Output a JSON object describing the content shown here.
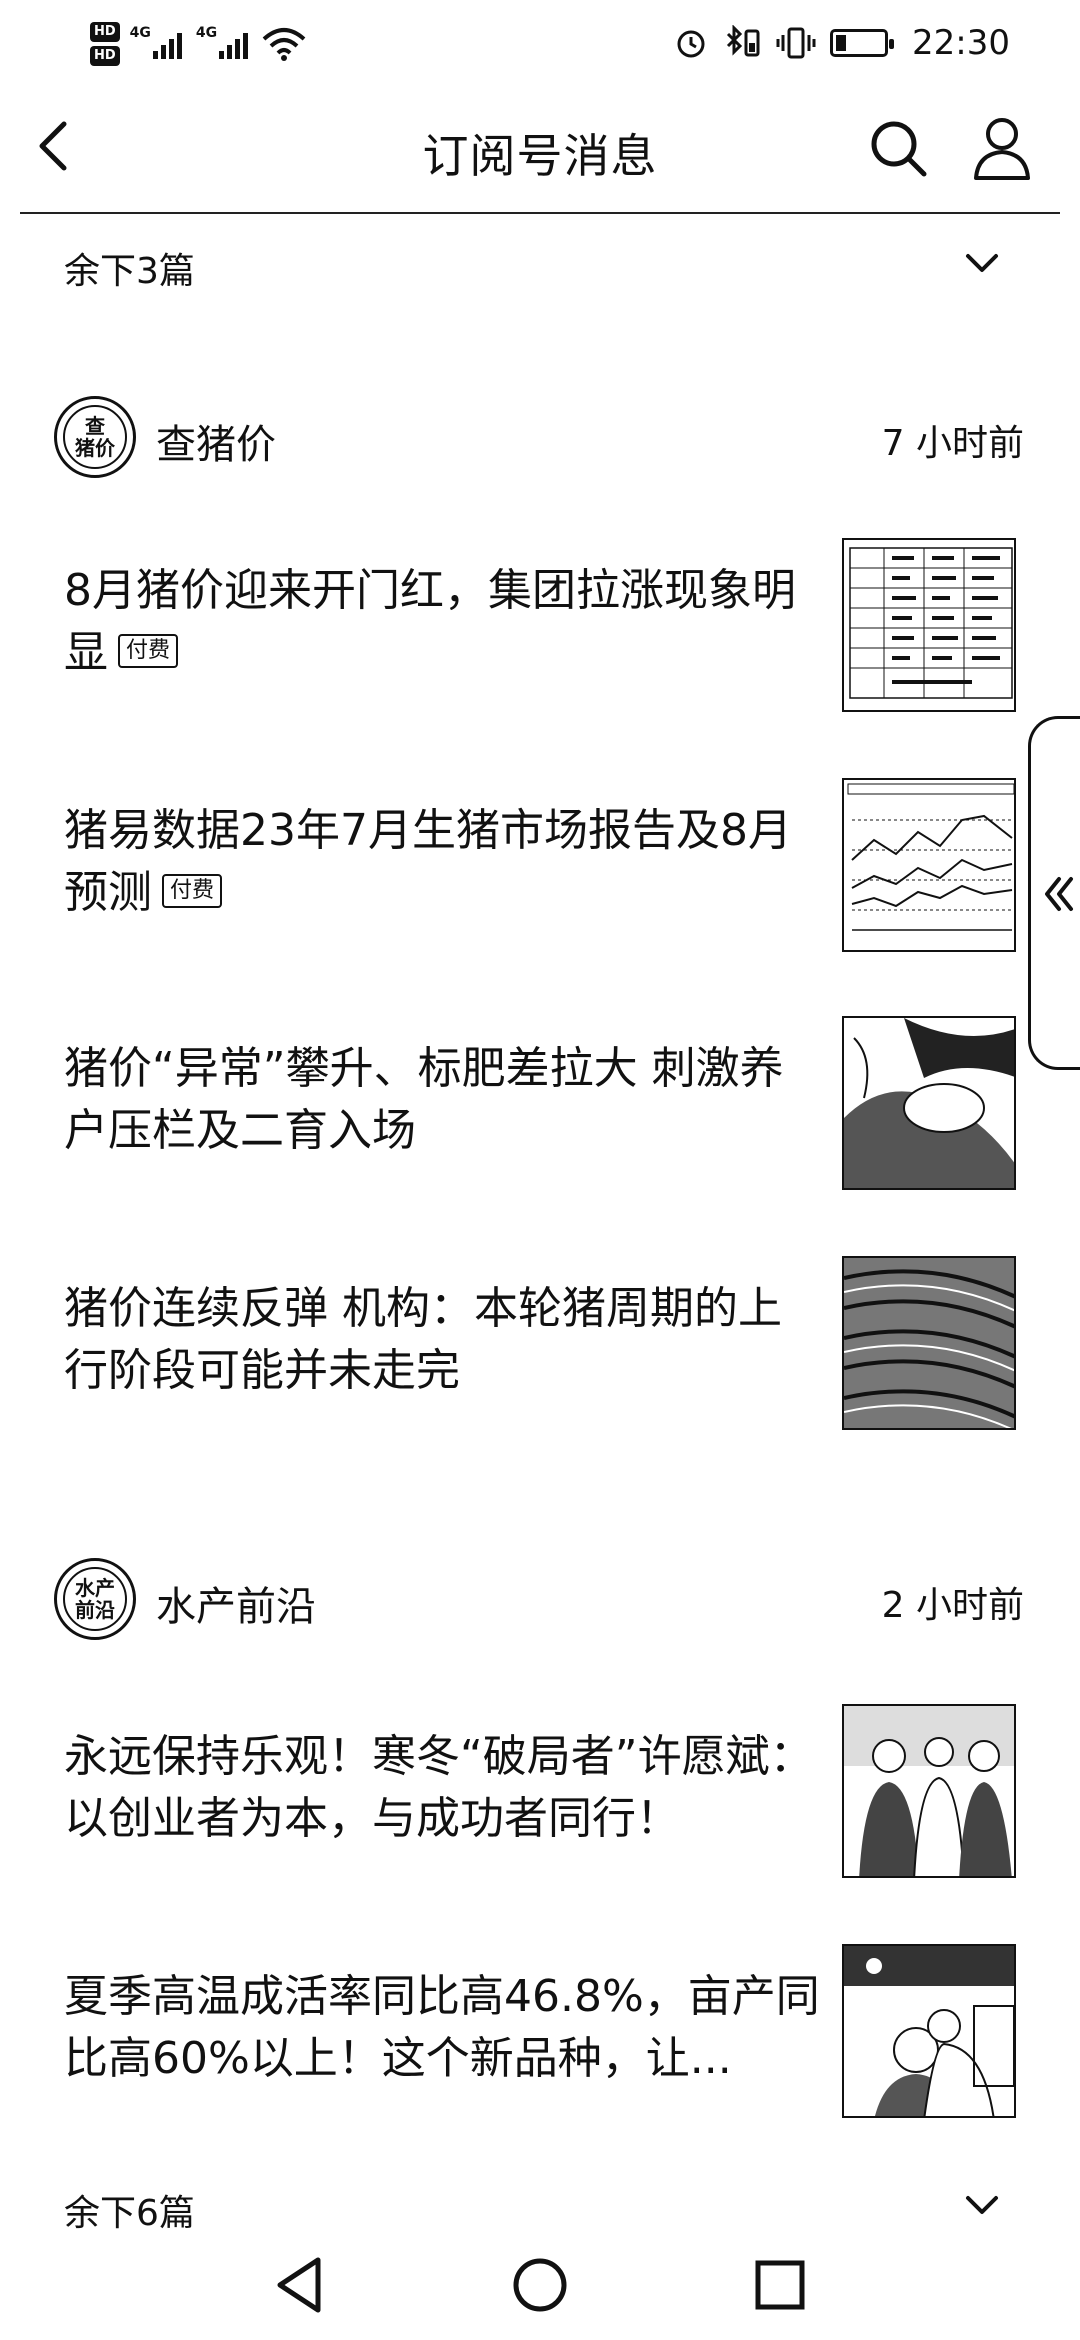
{
  "status_bar": {
    "hd1": "HD",
    "hd2": "HD",
    "sig1": "4G",
    "sig2": "4G",
    "time": "22:30"
  },
  "header": {
    "title": "订阅号消息"
  },
  "top_remaining": {
    "label": "余下3篇"
  },
  "accounts": [
    {
      "name": "查猪价",
      "avatar_text_top": "查",
      "avatar_text_bottom": "猪价",
      "time": "7 小时前",
      "articles": [
        {
          "title": "8月猪价迎来开门红，集团拉涨现象明显",
          "tag": "付费"
        },
        {
          "title": "猪易数据23年7月生猪市场报告及8月预测",
          "tag": "付费"
        },
        {
          "title": "猪价“异常”攀升、标肥差拉大 刺激养户压栏及二育入场"
        },
        {
          "title": "猪价连续反弹 机构：本轮猪周期的上行阶段可能并未走完"
        }
      ]
    },
    {
      "name": "水产前沿",
      "avatar_text_top": "水产",
      "avatar_text_bottom": "前沿",
      "time": "2 小时前",
      "articles": [
        {
          "title": "永远保持乐观！寒冬“破局者”许愿斌：以创业者为本，与成功者同行！"
        },
        {
          "title": "夏季高温成活率同比高46.8%，亩产同比高60%以上！这个新品种，让..."
        }
      ]
    }
  ],
  "bottom_remaining": {
    "label": "余下6篇"
  },
  "colors": {
    "ink": "#111111",
    "background": "#ffffff"
  }
}
